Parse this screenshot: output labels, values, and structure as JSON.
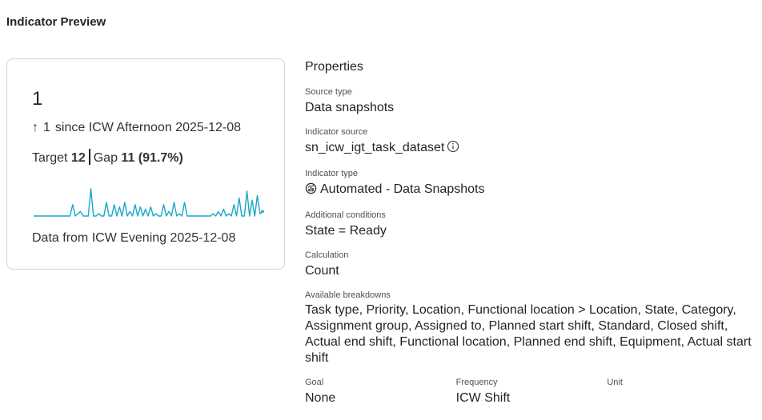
{
  "page": {
    "title": "Indicator Preview"
  },
  "card": {
    "score": "1",
    "change_arrow": "↑",
    "change_value": "1",
    "change_text": "since ICW Afternoon 2025-12-08",
    "target_label": "Target",
    "target_value": "12",
    "gap_label": "Gap",
    "gap_value": "11 (91.7%)",
    "data_from": "Data from ICW Evening 2025-12-08",
    "sparkline_color": "#1aa7c8",
    "sparkline_values": [
      0,
      0,
      0,
      0,
      0,
      0,
      0,
      0,
      0,
      0,
      0,
      0,
      0,
      0,
      0,
      5,
      0,
      1,
      2,
      0,
      0,
      0,
      12,
      0,
      0,
      1,
      0,
      0,
      6,
      0,
      0,
      5,
      0,
      4,
      0,
      6,
      0,
      2,
      0,
      5,
      0,
      4,
      0,
      3,
      0,
      4,
      0,
      1,
      0,
      0,
      5,
      0,
      2,
      0,
      6,
      0,
      1,
      0,
      6,
      0,
      0,
      0,
      0,
      0,
      0,
      0,
      0,
      0,
      0,
      1,
      0,
      2,
      0,
      3,
      0,
      1,
      0,
      5,
      0,
      8,
      0,
      0,
      11,
      0,
      7,
      0,
      9,
      1,
      2
    ]
  },
  "properties": {
    "heading": "Properties",
    "source_type": {
      "label": "Source type",
      "value": "Data snapshots"
    },
    "indicator_source": {
      "label": "Indicator source",
      "value": "sn_icw_igt_task_dataset"
    },
    "indicator_type": {
      "label": "Indicator type",
      "value": "Automated - Data Snapshots"
    },
    "additional_conditions": {
      "label": "Additional conditions",
      "value": "State = Ready"
    },
    "calculation": {
      "label": "Calculation",
      "value": "Count"
    },
    "available_breakdowns": {
      "label": "Available breakdowns",
      "value": "Task type, Priority, Location, Functional location > Location, State, Category, Assignment group, Assigned to, Planned start shift, Standard, Closed shift, Actual end shift, Functional location, Planned end shift, Equipment, Actual start shift"
    },
    "goal": {
      "label": "Goal",
      "value": "None"
    },
    "frequency": {
      "label": "Frequency",
      "value": "ICW Shift"
    },
    "unit": {
      "label": "Unit",
      "value": ""
    }
  }
}
